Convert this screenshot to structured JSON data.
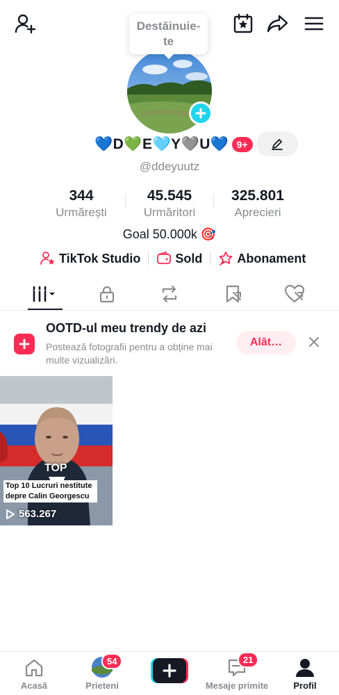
{
  "header": {
    "add_friend_icon": "add-user-icon",
    "calendar_icon": "calendar-star-icon",
    "share_icon": "share-icon",
    "menu_icon": "menu-icon",
    "tooltip_text": "Destăinuie-te"
  },
  "profile": {
    "display_name": "💙D💚E🩵Y🩶U💙",
    "notifications_badge": "9+",
    "username": "@ddeyuutz",
    "stats": [
      {
        "value": "344",
        "label": "Urmărești"
      },
      {
        "value": "45.545",
        "label": "Urmăritori"
      },
      {
        "value": "325.801",
        "label": "Aprecieri"
      }
    ],
    "bio": "Goal 50.000k 🎯",
    "links": [
      {
        "label": "TikTok Studio",
        "icon": "user-star-icon"
      },
      {
        "label": "Sold",
        "icon": "wallet-icon"
      },
      {
        "label": "Abonament",
        "icon": "star-badge-icon"
      }
    ]
  },
  "tabs": [
    {
      "name": "videos",
      "icon": "grid-icon",
      "active": true
    },
    {
      "name": "private",
      "icon": "lock-icon"
    },
    {
      "name": "reposts",
      "icon": "repost-icon"
    },
    {
      "name": "favorites",
      "icon": "bookmark-icon"
    },
    {
      "name": "liked",
      "icon": "heart-icon"
    }
  ],
  "promo": {
    "title": "OOTD-ul meu trendy de azi",
    "description": "Postează fotografii pentru a obține mai multe vizualizări.",
    "button_label": "Alăt…"
  },
  "videos": [
    {
      "overlay_top": "TOP",
      "caption": "Top 10 Lucruri  nestitute depre Calin Georgescu",
      "views": "563.267"
    }
  ],
  "bottom_nav": [
    {
      "label": "Acasă",
      "icon": "home-icon"
    },
    {
      "label": "Prieteni",
      "icon": "friends-avatar",
      "badge": "54"
    },
    {
      "label": "",
      "icon": "plus-icon"
    },
    {
      "label": "Mesaje primite",
      "icon": "inbox-icon",
      "badge": "21"
    },
    {
      "label": "Profil",
      "icon": "profile-icon",
      "active": true
    }
  ],
  "colors": {
    "accent": "#fe2c55",
    "cyan": "#20d5ec",
    "text": "#161823",
    "muted": "#8a8b91"
  }
}
